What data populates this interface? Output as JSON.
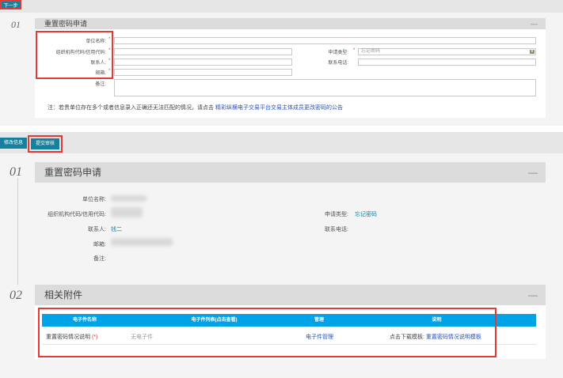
{
  "toolbar_top": {
    "next_label": "下一步"
  },
  "form_section": {
    "step": "01",
    "title": "重置密码申请",
    "collapse": "—",
    "labels": {
      "unit_name": "单位名称:",
      "org_code": "组织机构代码/信用代码:",
      "contact": "联系人:",
      "email": "邮箱:",
      "remark": "备注:",
      "apply_type": "申请类型:",
      "phone": "联系电话:"
    },
    "required_mark": "*",
    "apply_type_value": "忘记密码",
    "note_text": "注：若贵单位存在多个或者信息录入正确还无法匹配的情况，请点击",
    "note_link": "精彩纵横电子交易平台交易主体成员更改密码的公告"
  },
  "toolbar_mid": {
    "edit_label": "修改信息",
    "submit_label": "提交审核"
  },
  "review_section": {
    "step": "01",
    "title": "重置密码申请",
    "collapse": "—",
    "labels": {
      "unit_name": "单位名称:",
      "org_code": "组织机构代码/信用代码:",
      "contact": "联系人:",
      "email": "邮箱:",
      "remark": "备注:",
      "apply_type": "申请类型:",
      "phone": "联系电话:"
    },
    "values": {
      "contact": "钱二",
      "apply_type": "忘记密码"
    }
  },
  "attach_section": {
    "step": "02",
    "title": "相关附件",
    "collapse": "—",
    "columns": [
      "电子件名称",
      "电子件列表(点击查看)",
      "管理",
      "说明"
    ],
    "rows": [
      {
        "name": "重置密码情况说明",
        "required": "(*)",
        "files": "无电子件",
        "manage": "电子件管理",
        "desc_prefix": "点击下载模板:",
        "desc_link": "重置密码情况说明模板"
      }
    ]
  }
}
